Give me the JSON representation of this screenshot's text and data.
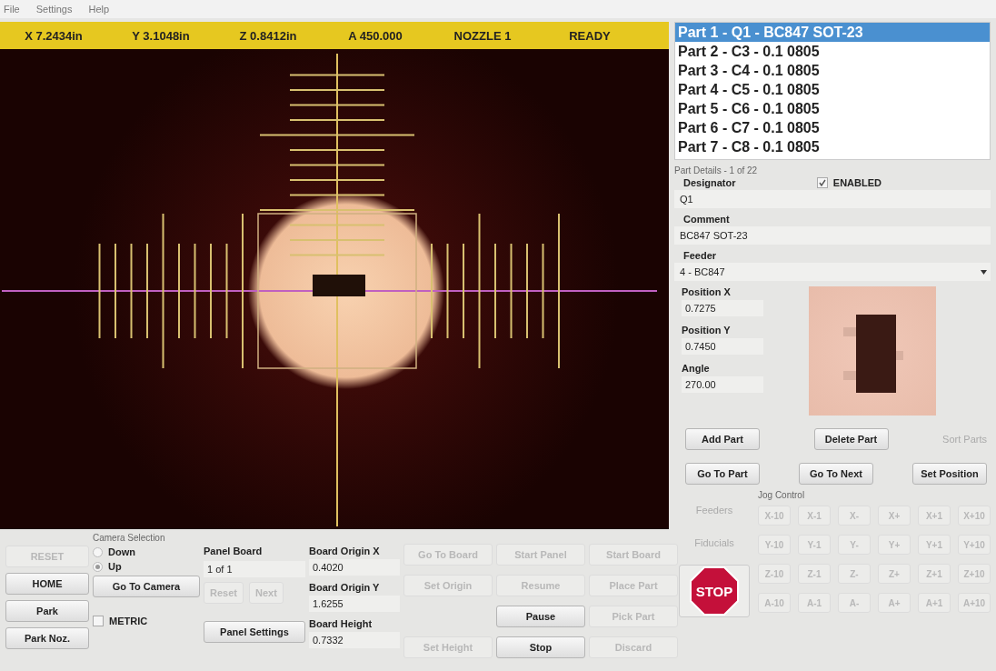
{
  "menu": [
    {
      "label": "File"
    },
    {
      "label": "Settings"
    },
    {
      "label": "Help"
    }
  ],
  "status_bar": [
    "X 7.2434in",
    "Y 3.1048in",
    "Z 0.8412in",
    "A 450.000",
    "NOZZLE 1",
    "READY"
  ],
  "parts": [
    {
      "label": "Part 1 - Q1 - BC847 SOT-23",
      "selected": true
    },
    {
      "label": "Part 2 - C3 - 0.1 0805",
      "selected": false
    },
    {
      "label": "Part 3 - C4 - 0.1 0805",
      "selected": false
    },
    {
      "label": "Part 4 - C5 - 0.1 0805",
      "selected": false
    },
    {
      "label": "Part 5 - C6 - 0.1 0805",
      "selected": false
    },
    {
      "label": "Part 6 - C7 - 0.1 0805",
      "selected": false
    },
    {
      "label": "Part 7 - C8 - 0.1 0805",
      "selected": false
    }
  ],
  "part_details": {
    "title": "Part Details - 1 of 22",
    "enabled": {
      "label": "ENABLED",
      "checked": true
    },
    "fields": [
      {
        "label": "Designator",
        "value": "Q1"
      },
      {
        "label": "Comment",
        "value": "BC847 SOT-23"
      }
    ],
    "feeder": {
      "label": "Feeder",
      "value": "4 - BC847"
    },
    "positions": [
      {
        "label": "Position X",
        "value": "0.7275"
      },
      {
        "label": "Position Y",
        "value": "0.7450"
      },
      {
        "label": "Angle",
        "value": "270.00"
      }
    ],
    "buttons": [
      [
        {
          "label": "Add Part",
          "disabled": false
        },
        {
          "label": "Delete Part",
          "disabled": false
        },
        {
          "label": "Sort Parts",
          "disabled": true
        }
      ],
      [
        {
          "label": "Go To Part",
          "disabled": false
        },
        {
          "label": "Go To Next",
          "disabled": false
        },
        {
          "label": "Set Position",
          "disabled": false
        }
      ]
    ]
  },
  "machine_buttons": [
    {
      "label": "RESET",
      "disabled": true
    },
    {
      "label": "HOME",
      "disabled": false
    },
    {
      "label": "Park",
      "disabled": false
    },
    {
      "label": "Park Noz.",
      "disabled": false
    }
  ],
  "camera_selection": {
    "title": "Camera Selection",
    "options": [
      {
        "label": "Down",
        "selected": false
      },
      {
        "label": "Up",
        "selected": true
      }
    ],
    "button": "Go To Camera",
    "metric": {
      "label": "METRIC",
      "checked": false
    }
  },
  "panel_board": {
    "label": "Panel Board",
    "value": "1 of 1",
    "buttons": [
      {
        "label": "Reset",
        "disabled": true
      },
      {
        "label": "Next",
        "disabled": true
      }
    ],
    "settings": "Panel Settings"
  },
  "board_origin": [
    {
      "label": "Board Origin X",
      "value": "0.4020"
    },
    {
      "label": "Board Origin Y",
      "value": "1.6255"
    },
    {
      "label": "Board Height",
      "value": "0.7332"
    }
  ],
  "run_buttons": [
    [
      {
        "kind": "button",
        "label": "Go To Board",
        "disabled": true
      },
      {
        "kind": "button",
        "label": "Set Origin",
        "disabled": true
      },
      {
        "kind": "gap"
      },
      {
        "kind": "button",
        "label": "Set Height",
        "disabled": true
      }
    ],
    [
      {
        "kind": "button",
        "label": "Start Panel",
        "disabled": true
      },
      {
        "kind": "button",
        "label": "Resume",
        "disabled": true
      },
      {
        "kind": "button",
        "label": "Pause",
        "disabled": false
      },
      {
        "kind": "button",
        "label": "Stop",
        "disabled": false
      }
    ],
    [
      {
        "kind": "button",
        "label": "Start Board",
        "disabled": true
      },
      {
        "kind": "button",
        "label": "Place Part",
        "disabled": true
      },
      {
        "kind": "button",
        "label": "Pick Part",
        "disabled": true
      },
      {
        "kind": "button",
        "label": "Discard",
        "disabled": true
      }
    ]
  ],
  "side_buttons": [
    {
      "label": "Feeders",
      "disabled": true
    },
    {
      "label": "Fiducials",
      "disabled": true
    }
  ],
  "stop_button": "STOP",
  "jog": {
    "title": "Jog Control",
    "rows": [
      [
        {
          "label": "X-10",
          "disabled": true
        },
        {
          "label": "X-1",
          "disabled": true
        },
        {
          "label": "X-",
          "disabled": true
        },
        {
          "label": "X+",
          "disabled": true
        },
        {
          "label": "X+1",
          "disabled": true
        },
        {
          "label": "X+10",
          "disabled": true
        }
      ],
      [
        {
          "label": "Y-10",
          "disabled": true
        },
        {
          "label": "Y-1",
          "disabled": true
        },
        {
          "label": "Y-",
          "disabled": true
        },
        {
          "label": "Y+",
          "disabled": true
        },
        {
          "label": "Y+1",
          "disabled": true
        },
        {
          "label": "Y+10",
          "disabled": true
        }
      ],
      [
        {
          "label": "Z-10",
          "disabled": true
        },
        {
          "label": "Z-1",
          "disabled": true
        },
        {
          "label": "Z-",
          "disabled": true
        },
        {
          "label": "Z+",
          "disabled": true
        },
        {
          "label": "Z+1",
          "disabled": true
        },
        {
          "label": "Z+10",
          "disabled": true
        }
      ],
      [
        {
          "label": "A-10",
          "disabled": true
        },
        {
          "label": "A-1",
          "disabled": true
        },
        {
          "label": "A-",
          "disabled": true
        },
        {
          "label": "A+",
          "disabled": true
        },
        {
          "label": "A+1",
          "disabled": true
        },
        {
          "label": "A+10",
          "disabled": true
        }
      ]
    ]
  }
}
